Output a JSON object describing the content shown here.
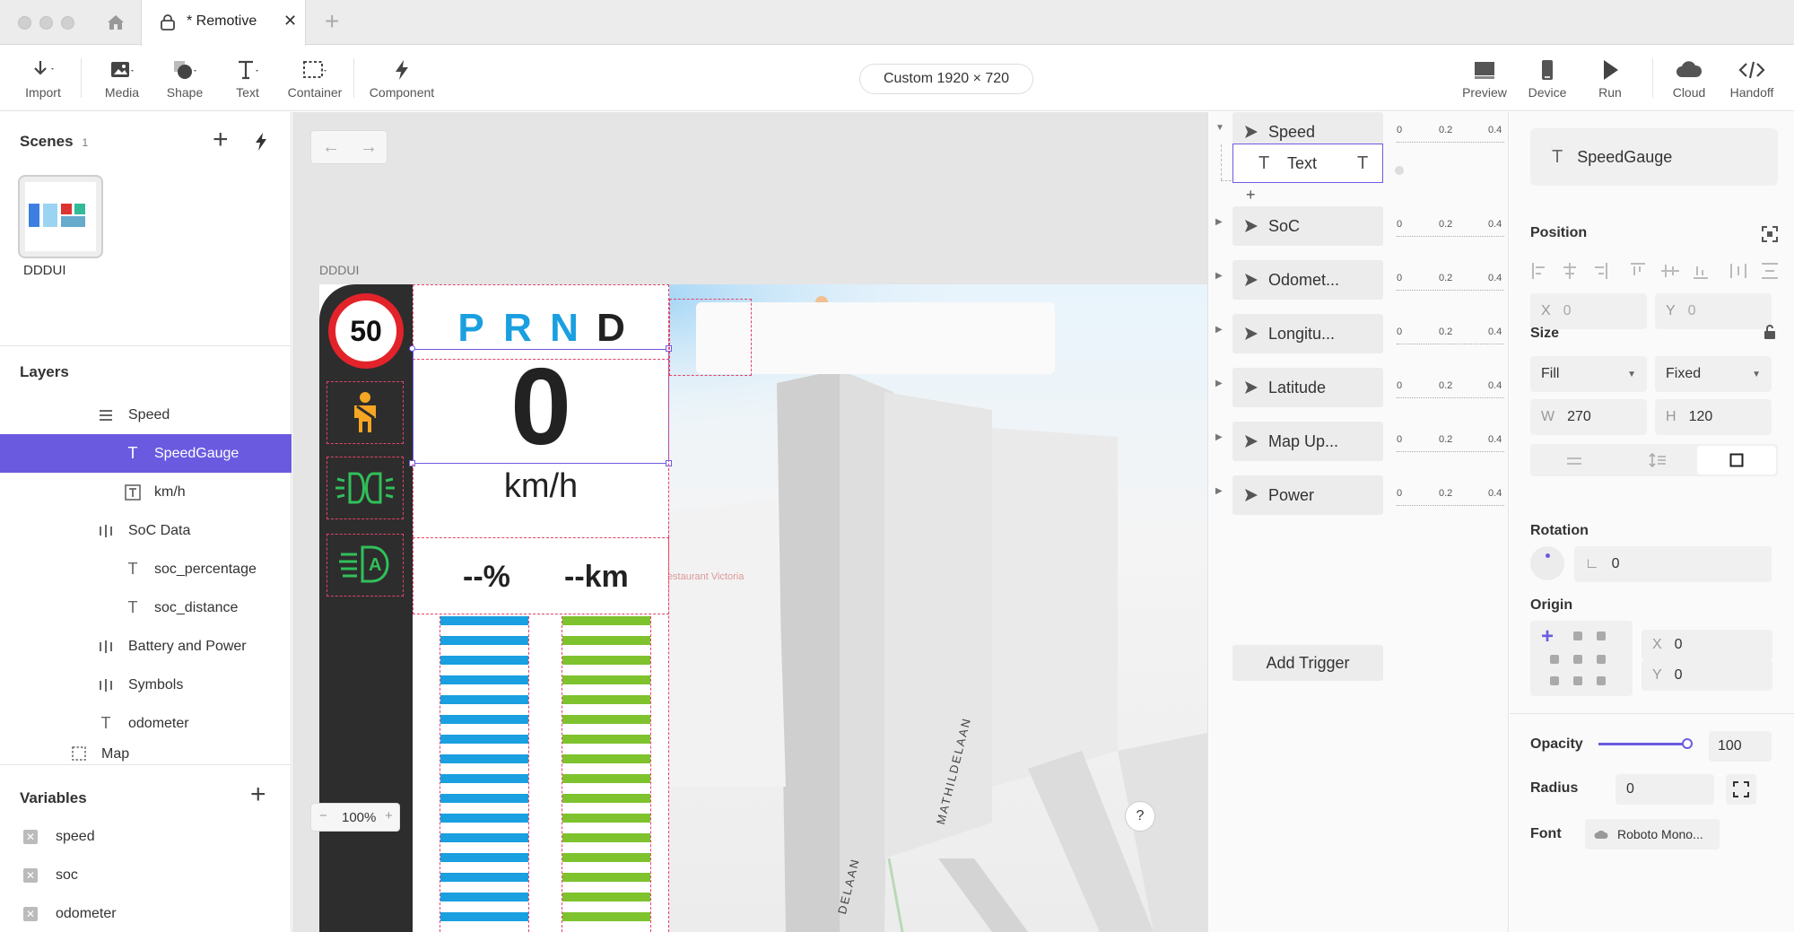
{
  "window": {
    "tab_title": "* Remotive"
  },
  "toolbar": {
    "tools": [
      "Import",
      "Media",
      "Shape",
      "Text",
      "Container",
      "Component"
    ],
    "canvas_size": "Custom  1920 × 720",
    "right_tools": [
      "Preview",
      "Device",
      "Run",
      "Cloud",
      "Handoff"
    ]
  },
  "scenes": {
    "title": "Scenes",
    "count": "1",
    "thumbnail_label": "DDDUI"
  },
  "layers": {
    "title": "Layers",
    "items": [
      {
        "label": "Speed",
        "icon": "stack-icon",
        "expanded": true
      },
      {
        "label": "SpeedGauge",
        "icon": "text-icon",
        "selected": true
      },
      {
        "label": "km/h",
        "icon": "text-box-icon"
      },
      {
        "label": "SoC Data",
        "icon": "columns-icon",
        "expanded": true
      },
      {
        "label": "soc_percentage",
        "icon": "text-icon"
      },
      {
        "label": "soc_distance",
        "icon": "text-icon"
      },
      {
        "label": "Battery and Power",
        "icon": "columns-icon",
        "expanded": false
      },
      {
        "label": "Symbols",
        "icon": "columns-icon",
        "expanded": false
      },
      {
        "label": "odometer",
        "icon": "text-icon"
      },
      {
        "label": "Map",
        "icon": "container-icon",
        "expanded": false
      }
    ]
  },
  "variables": {
    "title": "Variables",
    "items": [
      "speed",
      "soc",
      "odometer"
    ]
  },
  "canvas": {
    "frame_label": "DDDUI",
    "zoom": "100%",
    "help": "?",
    "speed_limit": "50",
    "gears": [
      "P",
      "R",
      "N",
      "D"
    ],
    "active_gear_count": 3,
    "speed_value": "0",
    "speed_unit": "km/h",
    "soc_percentage": "--%",
    "soc_distance": "--km",
    "bar_count": 16,
    "map_labels": [
      "Restaurant Victoria",
      "MATHILDELAAN",
      "DELAAN"
    ],
    "colors": {
      "blue": "#1a9fe0",
      "green": "#7ec22e",
      "red": "#e2232a",
      "amber": "#f5a623",
      "selection": "#6b5be0"
    }
  },
  "timeline": {
    "rows": [
      {
        "label": "Speed",
        "expanded": true
      },
      {
        "label": "SoC"
      },
      {
        "label": "Odomet..."
      },
      {
        "label": "Longitu..."
      },
      {
        "label": "Latitude"
      },
      {
        "label": "Map Up..."
      },
      {
        "label": "Power"
      }
    ],
    "child_row": "Text",
    "ticks": [
      "0",
      "0.2",
      "0.4"
    ],
    "add_trigger": "Add Trigger"
  },
  "inspector": {
    "element_name": "SpeedGauge",
    "position_label": "Position",
    "x_label": "X",
    "x_value": "0",
    "y_label": "Y",
    "y_value": "0",
    "size_label": "Size",
    "width_mode": "Fill",
    "height_mode": "Fixed",
    "w_label": "W",
    "w_value": "270",
    "h_label": "H",
    "h_value": "120",
    "rotation_label": "Rotation",
    "rotation_value": "0",
    "origin_label": "Origin",
    "origin_x_label": "X",
    "origin_x": "0",
    "origin_y_label": "Y",
    "origin_y": "0",
    "opacity_label": "Opacity",
    "opacity_value": "100",
    "radius_label": "Radius",
    "radius_value": "0",
    "font_label": "Font",
    "font_value": "Roboto Mono..."
  }
}
